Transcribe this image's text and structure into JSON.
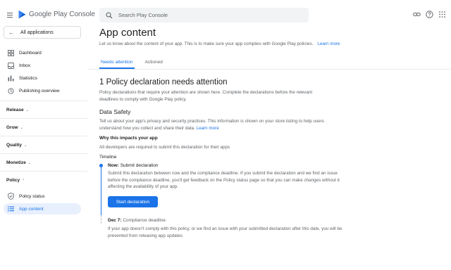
{
  "app": {
    "logo_text": "Google Play Console"
  },
  "sidebar": {
    "all_apps_label": "All applications",
    "items": [
      {
        "label": "Dashboard",
        "icon": "dashboard-icon"
      },
      {
        "label": "Inbox",
        "icon": "inbox-icon"
      },
      {
        "label": "Statistics",
        "icon": "statistics-icon"
      },
      {
        "label": "Publishing overview",
        "icon": "publishing-overview-icon"
      }
    ],
    "sections": [
      {
        "label": "Release"
      },
      {
        "label": "Grow"
      },
      {
        "label": "Quality"
      },
      {
        "label": "Monetize"
      },
      {
        "label": "Policy"
      }
    ],
    "policy_items": [
      {
        "label": "Policy status",
        "icon": "shield-icon"
      },
      {
        "label": "App content",
        "icon": "list-icon",
        "active": true
      }
    ]
  },
  "search": {
    "placeholder": "Search Play Console"
  },
  "page": {
    "title": "App content",
    "subtitle": "Let us know about the content of your app. This is to make sure your app complies with Google Play policies.",
    "learn_more": "Learn more",
    "tabs": [
      {
        "label": "Needs attention",
        "active": true
      },
      {
        "label": "Actioned",
        "active": false
      }
    ]
  },
  "attention": {
    "title": "1 Policy declaration needs attention",
    "description": "Policy declarations that require your attention are shown here. Complete the declarations before the relevant deadlines to comply with Google Play policy."
  },
  "data_safety": {
    "title": "Data Safety",
    "description": "Tell us about your app's privacy and security practices. This information is shown on your store listing to help users understand how you collect and share their data.",
    "learn_more": "Learn more",
    "why_title": "Why this impacts your app",
    "why_desc": "All developers are required to submit this declaration for their apps",
    "timeline_title": "Timeline",
    "step1_when": "Now:",
    "step1_title": "Submit declaration",
    "step1_desc": "Submit this declaration between now and the compliance deadline. If you submit the declaration and we find an issue before the compliance deadline, you'll get feedback on the Policy status page so that you can make changes without it affecting the availability of your app.",
    "start_button": "Start declaration",
    "step2_when": "Dec 7:",
    "step2_title": "Compliance deadline",
    "step2_desc": "If your app doesn't comply with this policy, or we find an issue with your submitted declaration after this date, you will be prevented from releasing app updates"
  },
  "colors": {
    "accent": "#1a73e8",
    "active_bg": "#e8f0fe"
  }
}
